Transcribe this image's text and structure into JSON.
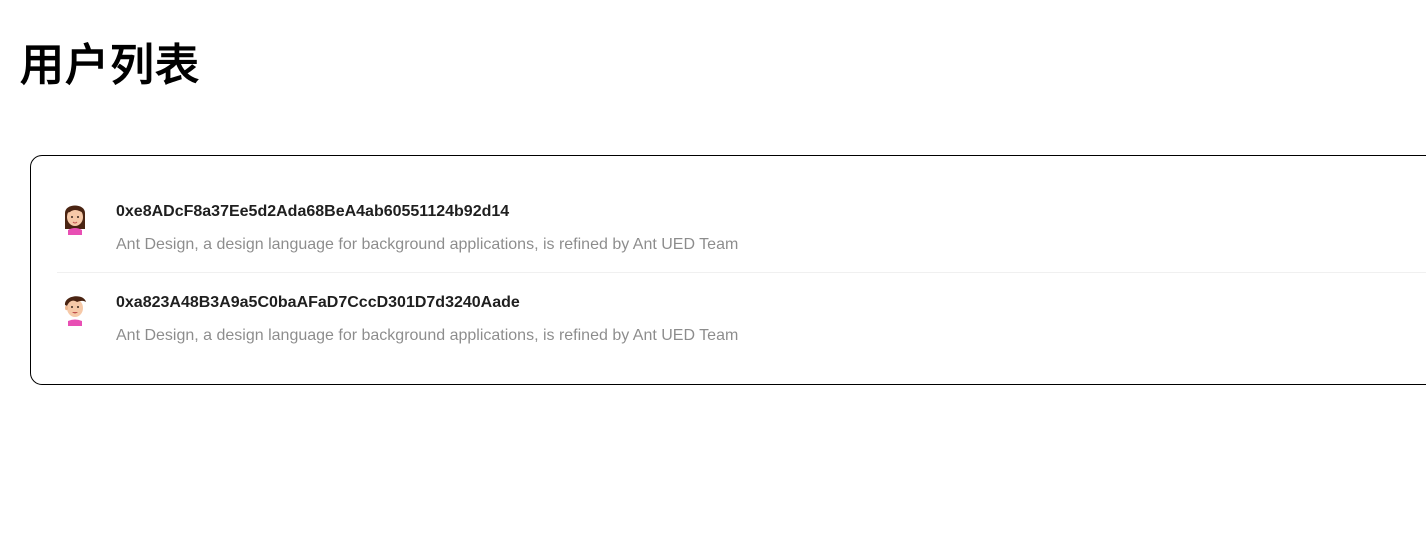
{
  "page": {
    "title": "用户列表"
  },
  "users": [
    {
      "address": "0xe8ADcF8a37Ee5d2Ada68BeA4ab60551124b92d14",
      "description": "Ant Design, a design language for background applications, is refined by Ant UED Team",
      "avatar": "female-avatar-icon"
    },
    {
      "address": "0xa823A48B3A9a5C0baAFaD7CccD301D7d3240Aade",
      "description": "Ant Design, a design language for background applications, is refined by Ant UED Team",
      "avatar": "male-avatar-icon"
    }
  ],
  "colors": {
    "border": "#000000",
    "divider": "#f0f0f0",
    "hair": "#4a2412",
    "skin": "#f6c9a8",
    "shirt": "#e84fb4"
  }
}
